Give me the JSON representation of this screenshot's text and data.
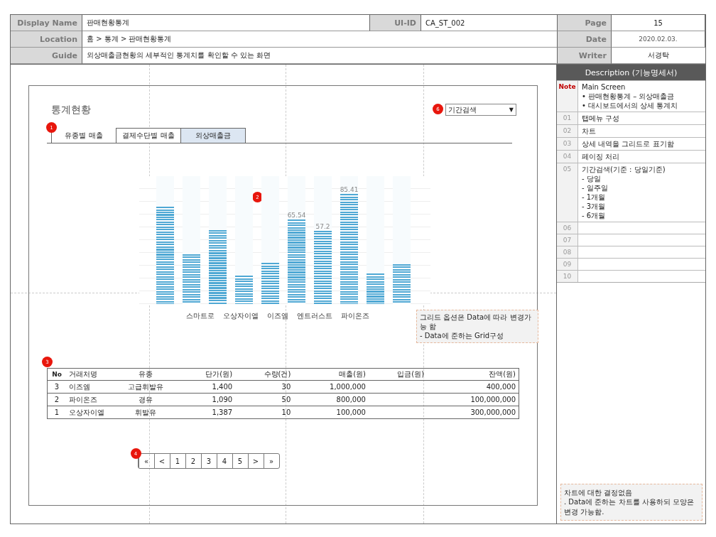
{
  "header": {
    "display_name_label": "Display Name",
    "display_name": "판매현황통계",
    "ui_id_label": "UI-ID",
    "ui_id": "CA_ST_002",
    "page_label": "Page",
    "page": "15",
    "location_label": "Location",
    "location": "홈 > 통계 > 판매현황통계",
    "date_label": "Date",
    "date": "2020.02.03.",
    "guide_label": "Guide",
    "guide": "외상매출금현황의 세부적인 통계치를 확인할 수 있는 화면",
    "writer_label": "Writer",
    "writer": "서경탁"
  },
  "screen": {
    "title": "통계현황",
    "period_select": {
      "value": "기간검색",
      "arrow": "▼",
      "badge": "6"
    },
    "tabs_badge": "1",
    "tabs": [
      {
        "label": "유종별 매출",
        "selected": true,
        "highlighted": false
      },
      {
        "label": "결제수단별 매출",
        "selected": false,
        "highlighted": false
      },
      {
        "label": "외상매출금",
        "selected": false,
        "highlighted": true
      }
    ],
    "chart": {
      "badge": "2",
      "bars": [
        {
          "level": 0.76
        },
        {
          "level": 0.39
        },
        {
          "level": 0.58
        },
        {
          "level": 0.22
        },
        {
          "level": 0.32
        },
        {
          "level": 0.66,
          "label": "65.54"
        },
        {
          "level": 0.57,
          "label": "57.2"
        },
        {
          "level": 0.86,
          "label": "85.41"
        },
        {
          "level": 0.24
        },
        {
          "level": 0.31
        }
      ],
      "category_labels": [
        "스마트로",
        "오상자이엘",
        "이즈엠",
        "엔트러스트",
        "파이온즈"
      ]
    },
    "chart_note": {
      "lines": [
        "그리드 옵션은 Data에 따라 변경가능 함",
        "- Data에 준하는 Grid구성"
      ]
    },
    "grid": {
      "badge": "3",
      "columns": [
        "No",
        "거래처명",
        "유종",
        "단가(원)",
        "수량(건)",
        "매출(원)",
        "입금(원)",
        "잔액(원)"
      ],
      "rows": [
        [
          "3",
          "이즈엠",
          "고급휘발유",
          "1,400",
          "30",
          "1,000,000",
          "",
          "400,000"
        ],
        [
          "2",
          "파이온즈",
          "경유",
          "1,090",
          "50",
          "800,000",
          "",
          "100,000,000"
        ],
        [
          "1",
          "오상자이엘",
          "휘발유",
          "1,387",
          "10",
          "100,000",
          "",
          "300,000,000"
        ]
      ]
    },
    "pagination": {
      "badge": "4",
      "items": [
        {
          "label": "«"
        },
        {
          "label": "<"
        },
        {
          "label": "1"
        },
        {
          "label": "2"
        },
        {
          "label": "3"
        },
        {
          "label": "4"
        },
        {
          "label": "5"
        },
        {
          "label": ">"
        },
        {
          "label": "»"
        }
      ]
    }
  },
  "description": {
    "title": "Description (기능명세서)",
    "rows": [
      {
        "number": "Note",
        "kind": "note",
        "lines": [
          "Main Screen",
          "• 판매현황통계 – 외상매출금",
          "• 대시보드에서의 상세 통계치"
        ]
      },
      {
        "number": "01",
        "kind": "item",
        "lines": [
          "탭메뉴 구성"
        ]
      },
      {
        "number": "02",
        "kind": "item",
        "lines": [
          "차트"
        ]
      },
      {
        "number": "03",
        "kind": "item",
        "lines": [
          "상세 내역을 그리드로 표기함"
        ]
      },
      {
        "number": "04",
        "kind": "item",
        "lines": [
          "페이징 처리"
        ]
      },
      {
        "number": "05",
        "kind": "item",
        "lines": [
          "기간검색(기준 : 당일기준)",
          "-  당일",
          "-  일주일",
          "-  1개월",
          "-  3개월",
          "-  6개월"
        ]
      },
      {
        "number": "06",
        "kind": "item",
        "lines": []
      },
      {
        "number": "07",
        "kind": "item",
        "lines": []
      },
      {
        "number": "08",
        "kind": "item",
        "lines": []
      },
      {
        "number": "09",
        "kind": "item",
        "lines": []
      },
      {
        "number": "10",
        "kind": "item",
        "lines": []
      }
    ],
    "note": {
      "lines": [
        "차트에 대한 결정없음",
        ". Data에 준하는 차트를 사용하되 모양은 변경 가능함."
      ]
    }
  }
}
